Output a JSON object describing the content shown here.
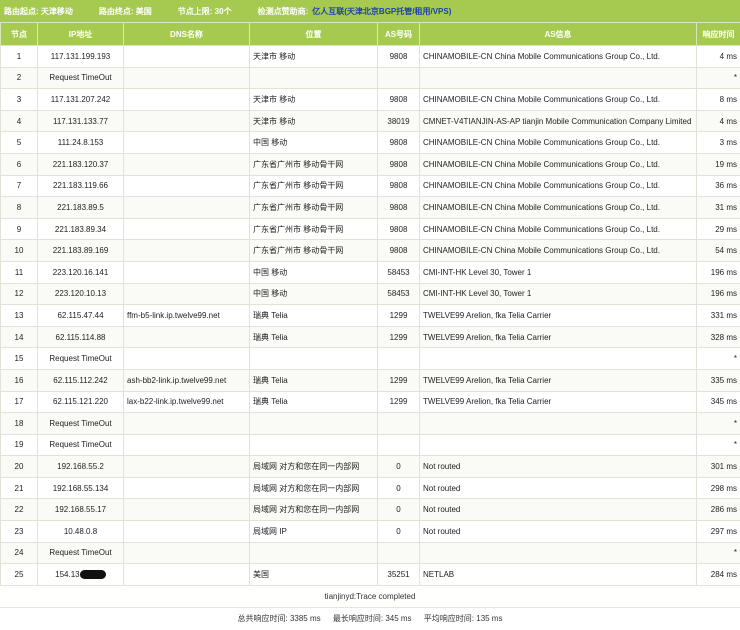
{
  "header": {
    "origin": "路由起点: 天津移动",
    "destination": "路由终点: 美国",
    "node_limit": "节点上限: 30个",
    "sponsor_label": "检测点赞助商:",
    "sponsor_name": "亿人互联",
    "sponsor_desc": "(天津北京BGP托管/租用/VPS)"
  },
  "columns": [
    "节点",
    "IP地址",
    "DNS名称",
    "位置",
    "AS号码",
    "AS信息",
    "响应时间"
  ],
  "rows": [
    {
      "hop": "1",
      "ip": "117.131.199.193",
      "dns": "",
      "loc": "天津市 移动",
      "asn": "9808",
      "asinfo": "CHINAMOBILE-CN China Mobile Communications Group Co., Ltd.",
      "time": "4 ms"
    },
    {
      "hop": "2",
      "ip": "Request TimeOut",
      "dns": "",
      "loc": "",
      "asn": "",
      "asinfo": "",
      "time": "*"
    },
    {
      "hop": "3",
      "ip": "117.131.207.242",
      "dns": "",
      "loc": "天津市 移动",
      "asn": "9808",
      "asinfo": "CHINAMOBILE-CN China Mobile Communications Group Co., Ltd.",
      "time": "8 ms"
    },
    {
      "hop": "4",
      "ip": "117.131.133.77",
      "dns": "",
      "loc": "天津市 移动",
      "asn": "38019",
      "asinfo": "CMNET-V4TIANJIN-AS-AP tianjin Mobile Communication Company Limited",
      "time": "4 ms"
    },
    {
      "hop": "5",
      "ip": "111.24.8.153",
      "dns": "",
      "loc": "中国 移动",
      "asn": "9808",
      "asinfo": "CHINAMOBILE-CN China Mobile Communications Group Co., Ltd.",
      "time": "3 ms"
    },
    {
      "hop": "6",
      "ip": "221.183.120.37",
      "dns": "",
      "loc": "广东省广州市 移动骨干网",
      "asn": "9808",
      "asinfo": "CHINAMOBILE-CN China Mobile Communications Group Co., Ltd.",
      "time": "19 ms"
    },
    {
      "hop": "7",
      "ip": "221.183.119.66",
      "dns": "",
      "loc": "广东省广州市 移动骨干网",
      "asn": "9808",
      "asinfo": "CHINAMOBILE-CN China Mobile Communications Group Co., Ltd.",
      "time": "36 ms"
    },
    {
      "hop": "8",
      "ip": "221.183.89.5",
      "dns": "",
      "loc": "广东省广州市 移动骨干网",
      "asn": "9808",
      "asinfo": "CHINAMOBILE-CN China Mobile Communications Group Co., Ltd.",
      "time": "31 ms"
    },
    {
      "hop": "9",
      "ip": "221.183.89.34",
      "dns": "",
      "loc": "广东省广州市 移动骨干网",
      "asn": "9808",
      "asinfo": "CHINAMOBILE-CN China Mobile Communications Group Co., Ltd.",
      "time": "29 ms"
    },
    {
      "hop": "10",
      "ip": "221.183.89.169",
      "dns": "",
      "loc": "广东省广州市 移动骨干网",
      "asn": "9808",
      "asinfo": "CHINAMOBILE-CN China Mobile Communications Group Co., Ltd.",
      "time": "54 ms"
    },
    {
      "hop": "11",
      "ip": "223.120.16.141",
      "dns": "",
      "loc": "中国 移动",
      "asn": "58453",
      "asinfo": "CMI-INT-HK Level 30, Tower 1",
      "time": "196 ms"
    },
    {
      "hop": "12",
      "ip": "223.120.10.13",
      "dns": "",
      "loc": "中国 移动",
      "asn": "58453",
      "asinfo": "CMI-INT-HK Level 30, Tower 1",
      "time": "196 ms"
    },
    {
      "hop": "13",
      "ip": "62.115.47.44",
      "dns": "ffm-b5-link.ip.twelve99.net",
      "loc": "瑞典 Telia",
      "asn": "1299",
      "asinfo": "TWELVE99 Arelion, fka Telia Carrier",
      "time": "331 ms"
    },
    {
      "hop": "14",
      "ip": "62.115.114.88",
      "dns": "",
      "loc": "瑞典 Telia",
      "asn": "1299",
      "asinfo": "TWELVE99 Arelion, fka Telia Carrier",
      "time": "328 ms"
    },
    {
      "hop": "15",
      "ip": "Request TimeOut",
      "dns": "",
      "loc": "",
      "asn": "",
      "asinfo": "",
      "time": "*"
    },
    {
      "hop": "16",
      "ip": "62.115.112.242",
      "dns": "ash-bb2-link.ip.twelve99.net",
      "loc": "瑞典 Telia",
      "asn": "1299",
      "asinfo": "TWELVE99 Arelion, fka Telia Carrier",
      "time": "335 ms"
    },
    {
      "hop": "17",
      "ip": "62.115.121.220",
      "dns": "lax-b22-link.ip.twelve99.net",
      "loc": "瑞典 Telia",
      "asn": "1299",
      "asinfo": "TWELVE99 Arelion, fka Telia Carrier",
      "time": "345 ms"
    },
    {
      "hop": "18",
      "ip": "Request TimeOut",
      "dns": "",
      "loc": "",
      "asn": "",
      "asinfo": "",
      "time": "*"
    },
    {
      "hop": "19",
      "ip": "Request TimeOut",
      "dns": "",
      "loc": "",
      "asn": "",
      "asinfo": "",
      "time": "*"
    },
    {
      "hop": "20",
      "ip": "192.168.55.2",
      "dns": "",
      "loc": "局域网 对方和您在同一内部网",
      "asn": "0",
      "asinfo": "Not routed",
      "time": "301 ms"
    },
    {
      "hop": "21",
      "ip": "192.168.55.134",
      "dns": "",
      "loc": "局域网 对方和您在同一内部网",
      "asn": "0",
      "asinfo": "Not routed",
      "time": "298 ms"
    },
    {
      "hop": "22",
      "ip": "192.168.55.17",
      "dns": "",
      "loc": "局域网 对方和您在同一内部网",
      "asn": "0",
      "asinfo": "Not routed",
      "time": "286 ms"
    },
    {
      "hop": "23",
      "ip": "10.48.0.8",
      "dns": "",
      "loc": "局域网 IP",
      "asn": "0",
      "asinfo": "Not routed",
      "time": "297 ms"
    },
    {
      "hop": "24",
      "ip": "Request TimeOut",
      "dns": "",
      "loc": "",
      "asn": "",
      "asinfo": "",
      "time": "*"
    },
    {
      "hop": "25",
      "ip": "154.13.",
      "dns": "",
      "loc": "美国",
      "asn": "35251",
      "asinfo": "NETLAB",
      "time": "284 ms"
    }
  ],
  "footer": {
    "trace_status": "tianjinyd:Trace completed",
    "total_time": "总共响应时间: 3385 ms",
    "max_time": "最长响应时间: 345 ms",
    "avg_time": "平均响应时间: 135 ms"
  },
  "colors": {
    "header_green": "#a6c94f",
    "sponsor_blue": "#1b3fb5"
  }
}
